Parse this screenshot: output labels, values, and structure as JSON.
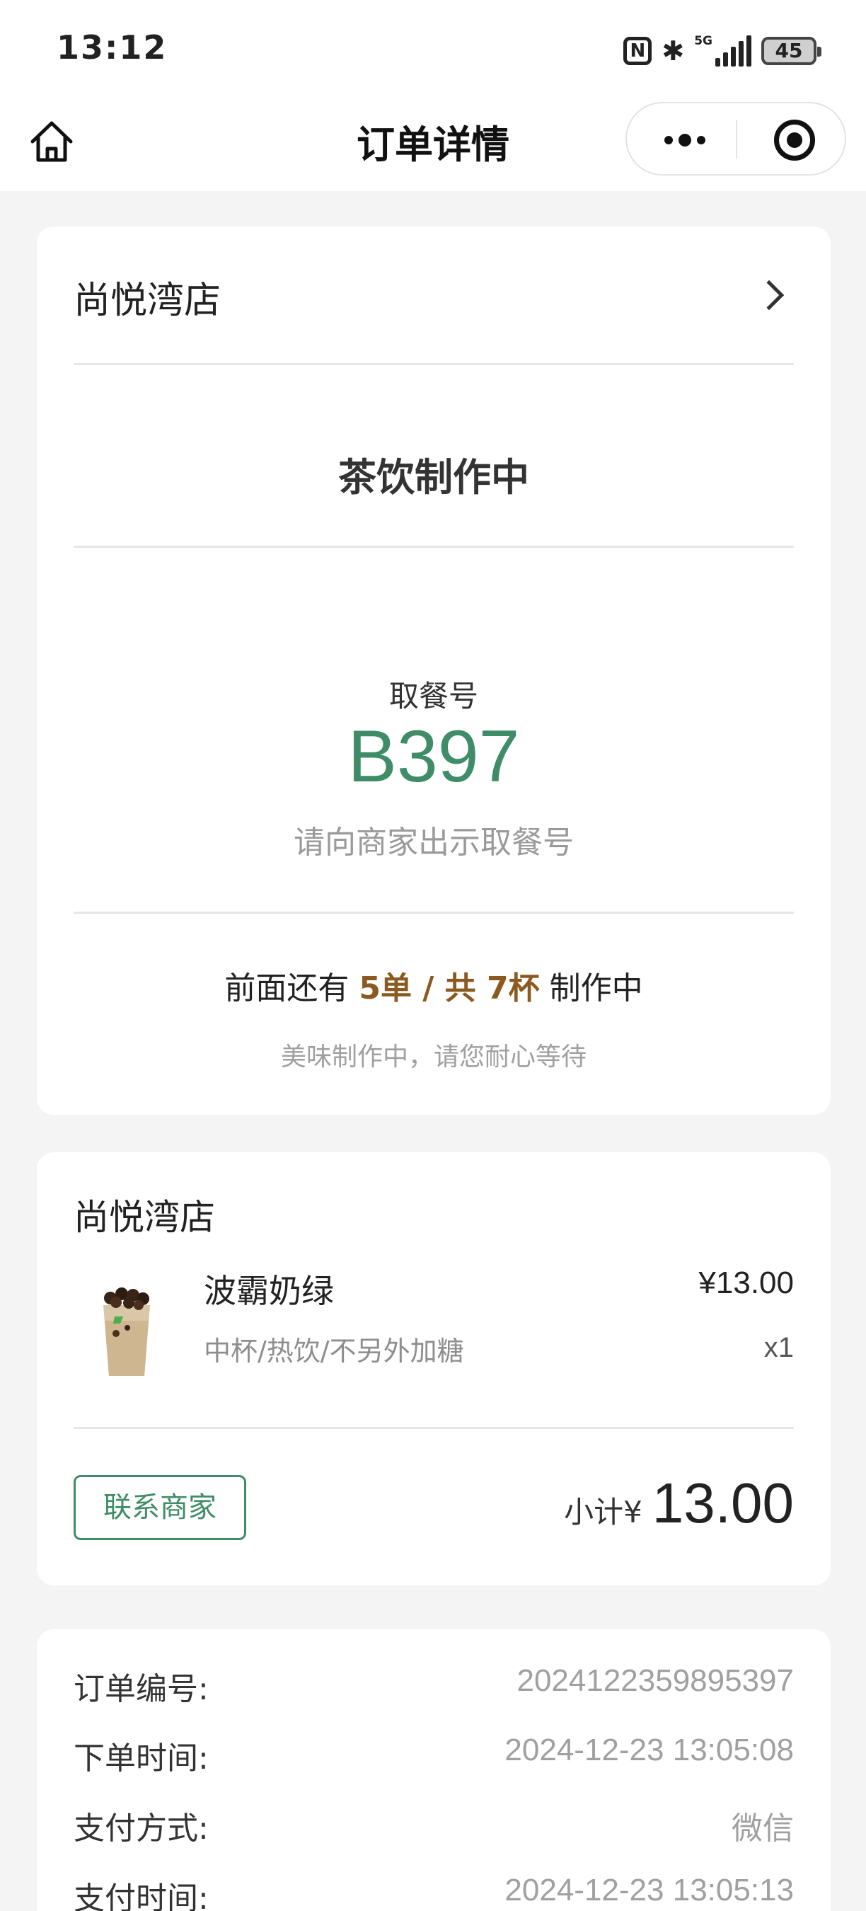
{
  "status_bar": {
    "time": "13:12",
    "nfc_label": "N",
    "bluetooth_glyph": "✱",
    "network_label": "5G",
    "battery": "45"
  },
  "nav": {
    "title": "订单详情",
    "icons": [
      "home-icon",
      "more-icon",
      "close-icon"
    ]
  },
  "order_card": {
    "store_name": "尚悦湾店",
    "status": "茶饮制作中",
    "pickup_label": "取餐号",
    "pickup_number": "B397",
    "pickup_hint": "请向商家出示取餐号",
    "queue_prefix": "前面还有 ",
    "queue_count": "5单 / 共 7杯",
    "queue_suffix": " 制作中",
    "queue_hint": "美味制作中，请您耐心等待"
  },
  "items_card": {
    "store_name": "尚悦湾店",
    "items": [
      {
        "name": "波霸奶绿",
        "spec": "中杯/热饮/不另外加糖",
        "price": "¥13.00",
        "qty": "x1"
      }
    ],
    "contact_button": "联系商家",
    "subtotal_label": "小计¥",
    "subtotal_value": "13.00"
  },
  "info_card": {
    "rows": [
      {
        "label": "订单编号:",
        "value": "2024122359895397"
      },
      {
        "label": "下单时间:",
        "value": "2024-12-23 13:05:08"
      },
      {
        "label": "支付方式:",
        "value": "微信"
      },
      {
        "label": "支付时间:",
        "value": "2024-12-23 13:05:13"
      }
    ]
  },
  "colors": {
    "accent_green": "#3f8c68",
    "highlight_brown": "#8b5a20",
    "background": "#f4f4f4"
  }
}
